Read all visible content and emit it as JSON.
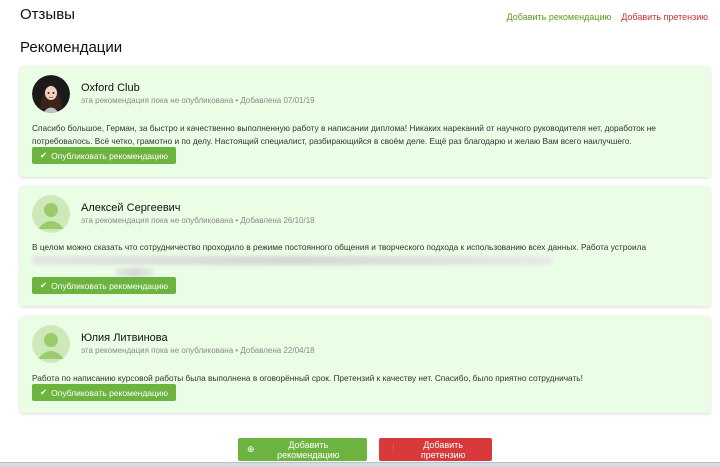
{
  "header": {
    "title": "Отзывы",
    "add_recommendation_link": "Добавить рекомендацию",
    "add_claim_link": "Добавить претензию"
  },
  "section": {
    "title": "Рекомендации"
  },
  "reviews": [
    {
      "author": "Oxford Club",
      "meta": "эта рекомендация пока не опубликована • Добавлена 07/01/19",
      "text": "Спасибо большое, Герман, за быстро и качественно выполненную работу в написании диплома! Никаких нареканий от научного руководителя нет, доработок не потребовалось. Всё четко, грамотно и по делу. Настоящий специалист, разбирающийся в своём деле. Ещё раз благодарю и желаю Вам всего наилучшего.",
      "publish_label": "Опубликовать рекомендацию",
      "avatar": "custom-photo"
    },
    {
      "author": "Алексей Сергеевич",
      "meta": "эта рекомендация пока не опубликована • Добавлена 26/10/18",
      "text": "В целом можно сказать что сотрудничество проходило в режиме постоянного общения и творческого подхода к использованию всех данных.  Работа устроила",
      "publish_label": "Опубликовать рекомендацию",
      "avatar": "default-user"
    },
    {
      "author": "Юлия Литвинова",
      "meta": "эта рекомендация пока не опубликована • Добавлена 22/04/18",
      "text": "Работа по написанию курсовой работы была выполнена в оговорённый срок. Претензий к качеству нет. Спасибо, было приятно сотрудничать!",
      "publish_label": "Опубликовать рекомендацию",
      "avatar": "default-user"
    }
  ],
  "footer": {
    "add_recommendation_button": "Добавить рекомендацию",
    "add_claim_button": "Добавить претензию"
  },
  "colors": {
    "card_bg": "#eafde5",
    "green": "#6db33f",
    "red": "#d9393a"
  }
}
